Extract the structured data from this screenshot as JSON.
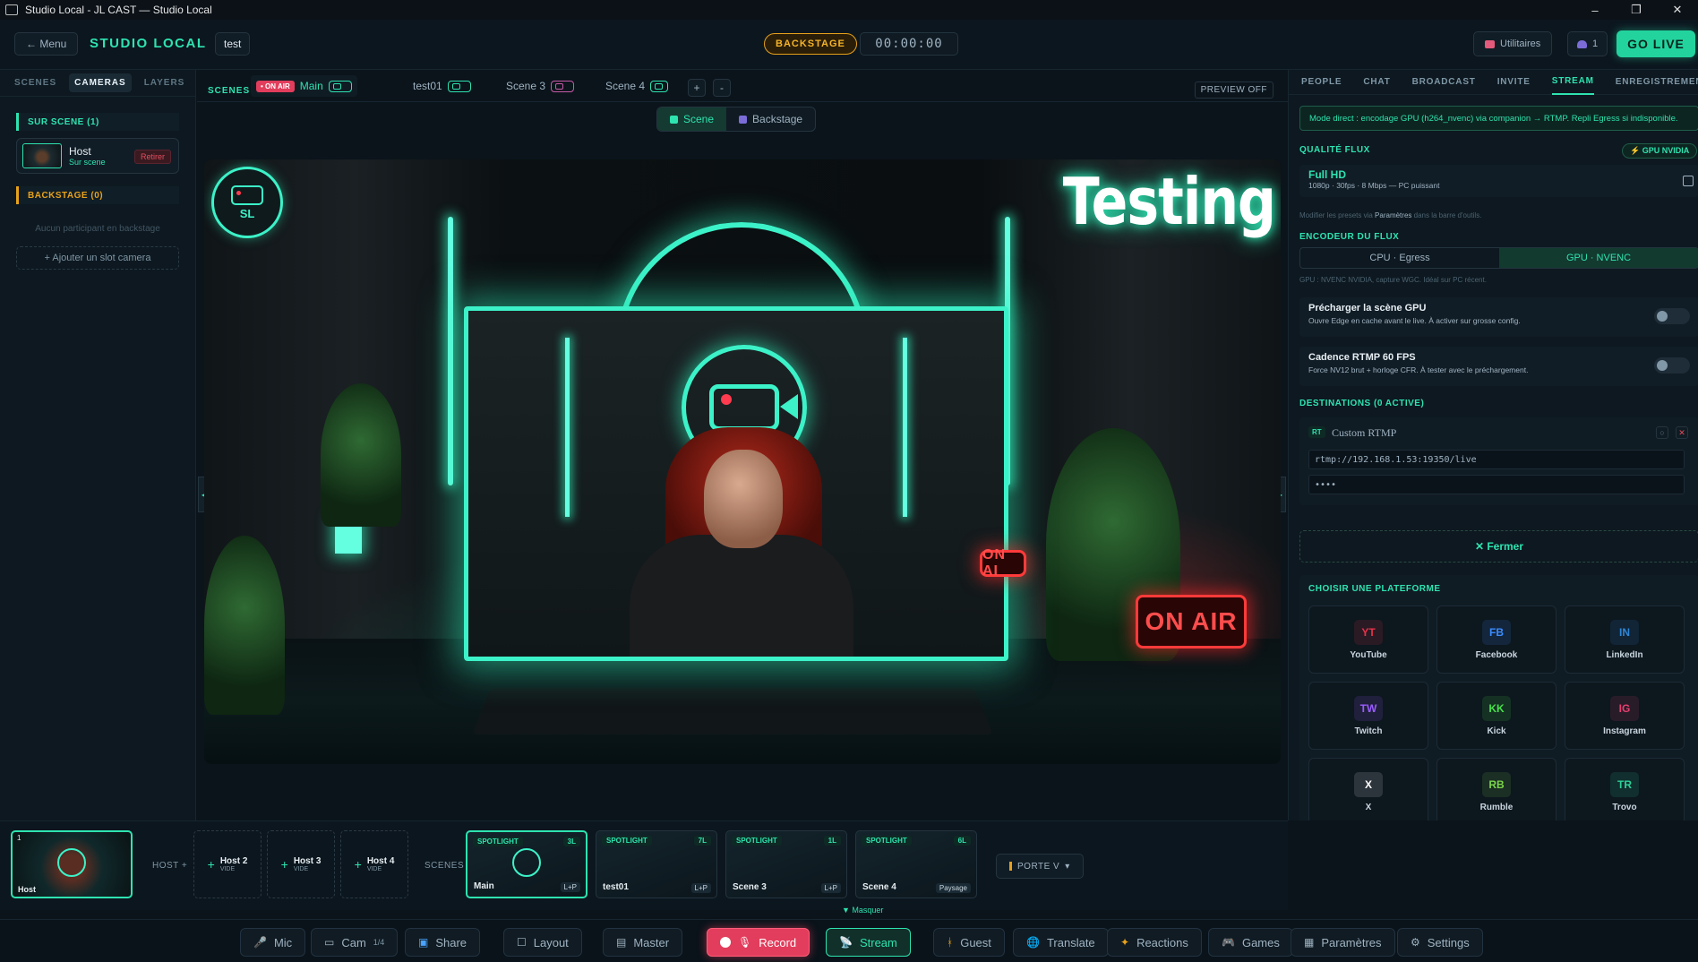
{
  "window": {
    "title": "Studio Local - JL CAST — Studio Local",
    "minimize": "–",
    "maximize": "❐",
    "close": "✕"
  },
  "header": {
    "menu_label": "← Menu",
    "brand": "STUDIO LOCAL",
    "project": "test",
    "status": "BACKSTAGE",
    "timer": "00:00:00",
    "utilities_label": "Utilitaires",
    "guests_count": "1",
    "go_live_label": "GO LIVE"
  },
  "left": {
    "tabs": [
      "SCENES",
      "CAMERAS",
      "LAYERS"
    ],
    "active_tab": "CAMERAS",
    "on_stage_title": "SUR SCENE (1)",
    "host": {
      "name": "Host",
      "status": "Sur scene",
      "remove_label": "Retirer"
    },
    "backstage_title": "BACKSTAGE (0)",
    "backstage_empty": "Aucun participant en backstage",
    "add_slot_label": "+ Ajouter un slot camera"
  },
  "scenebar": {
    "label": "SCENES",
    "onair_badge": "• ON AIR",
    "tabs": [
      "Main",
      "test01",
      "Scene 3",
      "Scene 4"
    ],
    "add": "+",
    "remove": "-",
    "preview_off": "PREVIEW OFF"
  },
  "view_switch": {
    "scene": "Scene",
    "backstage": "Backstage"
  },
  "stage": {
    "logo_text": "SL",
    "overlay_text": "Testing",
    "onair_small": "ON AI",
    "onair_big": "ON AIR",
    "arrow_left": "◀",
    "arrow_right": "▶"
  },
  "strip": {
    "host_thumb": {
      "num": "1",
      "label": "Host"
    },
    "host_label": "HOST +",
    "slots": [
      {
        "name": "Host 2",
        "sub": "VIDE"
      },
      {
        "name": "Host 3",
        "sub": "VIDE"
      },
      {
        "name": "Host 4",
        "sub": "VIDE"
      }
    ],
    "scenes_label": "SCENES",
    "scene_cards": [
      {
        "tag": "SPOTLIGHT",
        "badge": "3L",
        "name": "Main",
        "mode": "L+P"
      },
      {
        "tag": "SPOTLIGHT",
        "badge": "7L",
        "name": "test01",
        "mode": "L+P"
      },
      {
        "tag": "SPOTLIGHT",
        "badge": "1L",
        "name": "Scene 3",
        "mode": "L+P"
      },
      {
        "tag": "SPOTLIGHT",
        "badge": "6L",
        "name": "Scene 4",
        "mode": "Paysage"
      }
    ],
    "porte_label": "PORTE V",
    "porte_caret": "▾",
    "hide_label": "▼ Masquer"
  },
  "toolbar": {
    "mic": "Mic",
    "cam": "Cam",
    "cam_fraction": "1/4",
    "share": "Share",
    "layout": "Layout",
    "master": "Master",
    "record": "Record",
    "stream": "Stream",
    "guest": "Guest",
    "translate": "Translate",
    "reactions": "Reactions",
    "games": "Games",
    "parametres": "Paramètres",
    "settings": "Settings"
  },
  "right": {
    "tabs": [
      "PEOPLE",
      "CHAT",
      "BROADCAST",
      "INVITE",
      "STREAM",
      "ENREGISTREMENT"
    ],
    "active_tab": "STREAM",
    "banner": "Mode direct : encodage GPU (h264_nvenc) via companion → RTMP. Repli Egress si indisponible.",
    "quality_title": "QUALITÉ FLUX",
    "gpu_badge": "⚡ GPU NVIDIA",
    "quality_name": "Full HD",
    "quality_desc": "1080p · 30fps · 8 Mbps — PC puissant",
    "quality_note_pre": "Modifier les presets via",
    "quality_note_link": "Paramètres",
    "quality_note_post": "dans la barre d'outils.",
    "encoder_title": "ENCODEUR DU FLUX",
    "encoder_options": [
      "CPU · Egress",
      "GPU · NVENC"
    ],
    "encoder_active": "GPU · NVENC",
    "encoder_note": "GPU : NVENC NVIDIA, capture WGC. Idéal sur PC récent.",
    "preload": {
      "title": "Précharger la scène GPU",
      "desc": "Ouvre Edge en cache avant le live. À activer sur grosse config."
    },
    "cadence": {
      "title": "Cadence RTMP 60 FPS",
      "desc": "Force NV12 brut + horloge CFR. À tester avec le préchargement."
    },
    "destinations_title": "DESTINATIONS (0 ACTIVE)",
    "destination": {
      "badge": "RT",
      "name": "Custom RTMP",
      "url": "rtmp://192.168.1.53:19350/live",
      "key": "••••"
    },
    "close_label": "✕ Fermer",
    "platforms_title": "CHOISIR UNE PLATEFORME",
    "platforms": [
      {
        "abbr": "YT",
        "name": "YouTube",
        "color": "#e6334a"
      },
      {
        "abbr": "FB",
        "name": "Facebook",
        "color": "#3b8cff"
      },
      {
        "abbr": "IN",
        "name": "LinkedIn",
        "color": "#2f86d6"
      },
      {
        "abbr": "TW",
        "name": "Twitch",
        "color": "#9b5cff"
      },
      {
        "abbr": "KK",
        "name": "Kick",
        "color": "#48e04b"
      },
      {
        "abbr": "IG",
        "name": "Instagram",
        "color": "#e4406f"
      },
      {
        "abbr": "X",
        "name": "X",
        "color": "#ffffff"
      },
      {
        "abbr": "RB",
        "name": "Rumble",
        "color": "#7bd44b"
      },
      {
        "abbr": "TR",
        "name": "Trovo",
        "color": "#2ed198"
      }
    ]
  },
  "colors": {
    "accent": "#2ee3b0",
    "warning": "#e7a11b",
    "danger": "#e23d5c",
    "background": "#0b141b"
  }
}
